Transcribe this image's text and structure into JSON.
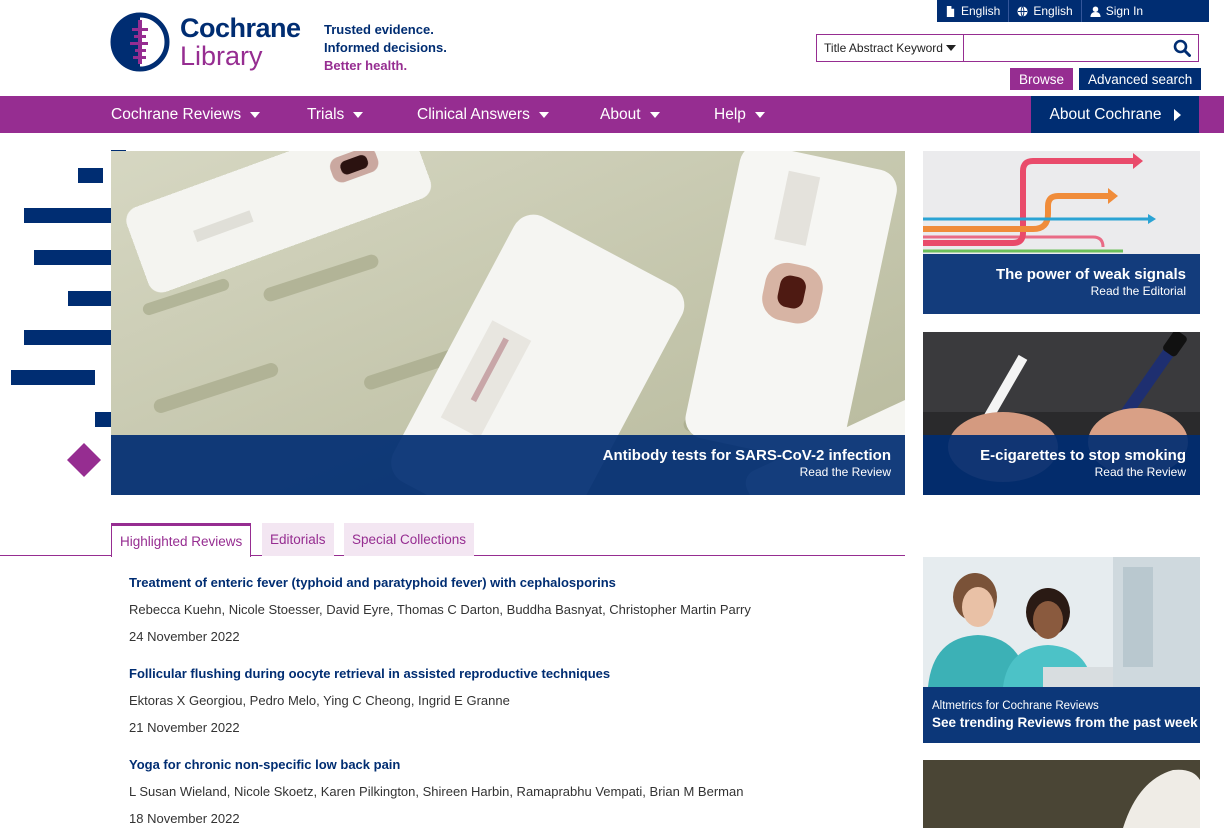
{
  "utility_bar": {
    "items": [
      {
        "icon": "file-icon",
        "label": "English"
      },
      {
        "icon": "globe-icon",
        "label": "English"
      },
      {
        "icon": "user-icon",
        "label": "Sign In"
      }
    ]
  },
  "logo": {
    "line1": "Cochrane",
    "line2": "Library"
  },
  "tagline": [
    "Trusted evidence.",
    "Informed decisions.",
    "Better health."
  ],
  "search": {
    "scope": "Title Abstract Keyword",
    "value": "",
    "placeholder": ""
  },
  "browse_label": "Browse",
  "advanced_search_label": "Advanced search",
  "nav": {
    "items": [
      {
        "label": "Cochrane Reviews"
      },
      {
        "label": "Trials"
      },
      {
        "label": "Clinical Answers"
      },
      {
        "label": "About"
      },
      {
        "label": "Help"
      }
    ],
    "about_cochrane": "About Cochrane"
  },
  "hero": {
    "title": "Antibody tests for SARS-CoV-2 infection",
    "subtitle": "Read the Review"
  },
  "side_cards": [
    {
      "title": "The power of weak signals",
      "subtitle": "Read the Editorial"
    },
    {
      "title": "E-cigarettes to stop smoking",
      "subtitle": "Read the Review"
    },
    {
      "title": "Altmetrics for Cochrane Reviews",
      "subtitle": "See trending Reviews from the past week"
    }
  ],
  "tabs": [
    {
      "label": "Highlighted Reviews",
      "active": true
    },
    {
      "label": "Editorials",
      "active": false
    },
    {
      "label": "Special Collections",
      "active": false
    }
  ],
  "reviews": [
    {
      "title": "Treatment of enteric fever (typhoid and paratyphoid fever) with cephalosporins",
      "authors": "Rebecca Kuehn, Nicole Stoesser, David Eyre, Thomas C Darton, Buddha Basnyat, Christopher Martin Parry",
      "date": "24 November 2022"
    },
    {
      "title": "Follicular flushing during oocyte retrieval in assisted reproductive techniques",
      "authors": "Ektoras X Georgiou, Pedro Melo, Ying C Cheong, Ingrid E Granne",
      "date": "21 November 2022"
    },
    {
      "title": "Yoga for chronic non-specific low back pain",
      "authors": "L Susan Wieland, Nicole Skoetz, Karen Pilkington, Shireen Harbin, Ramaprabhu Vempati, Brian M Berman",
      "date": "18 November 2022"
    }
  ],
  "colors": {
    "brand_purple": "#962d91",
    "brand_navy": "#002d72"
  }
}
